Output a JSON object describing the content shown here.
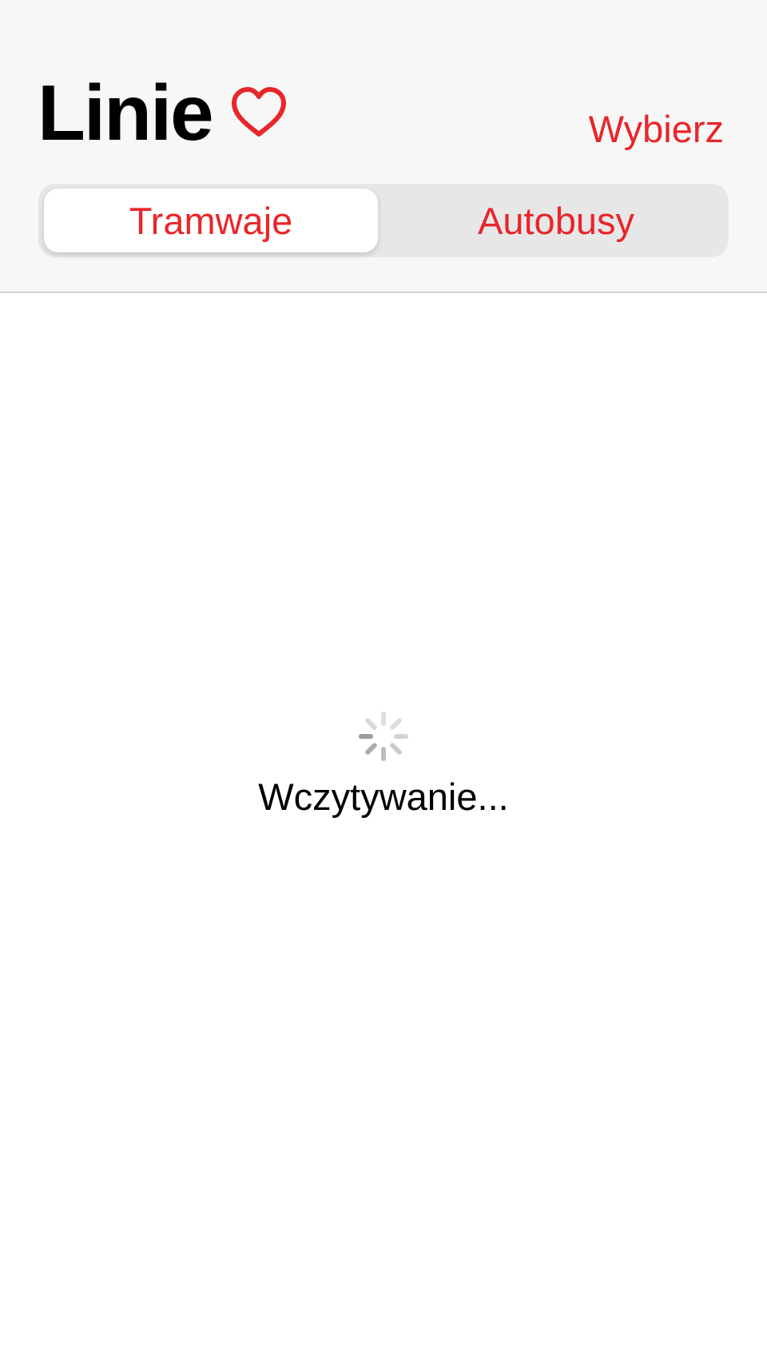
{
  "header": {
    "title": "Linie",
    "select_label": "Wybierz"
  },
  "segments": [
    {
      "label": "Tramwaje",
      "selected": true
    },
    {
      "label": "Autobusy",
      "selected": false
    }
  ],
  "loading": {
    "text": "Wczytywanie..."
  },
  "icons": {
    "favorite": "heart-outline-icon",
    "activity": "spinner-icon"
  },
  "colors": {
    "accent": "#e8262a",
    "header_background": "#f7f7f7",
    "segmented_background": "#e7e7e8"
  }
}
